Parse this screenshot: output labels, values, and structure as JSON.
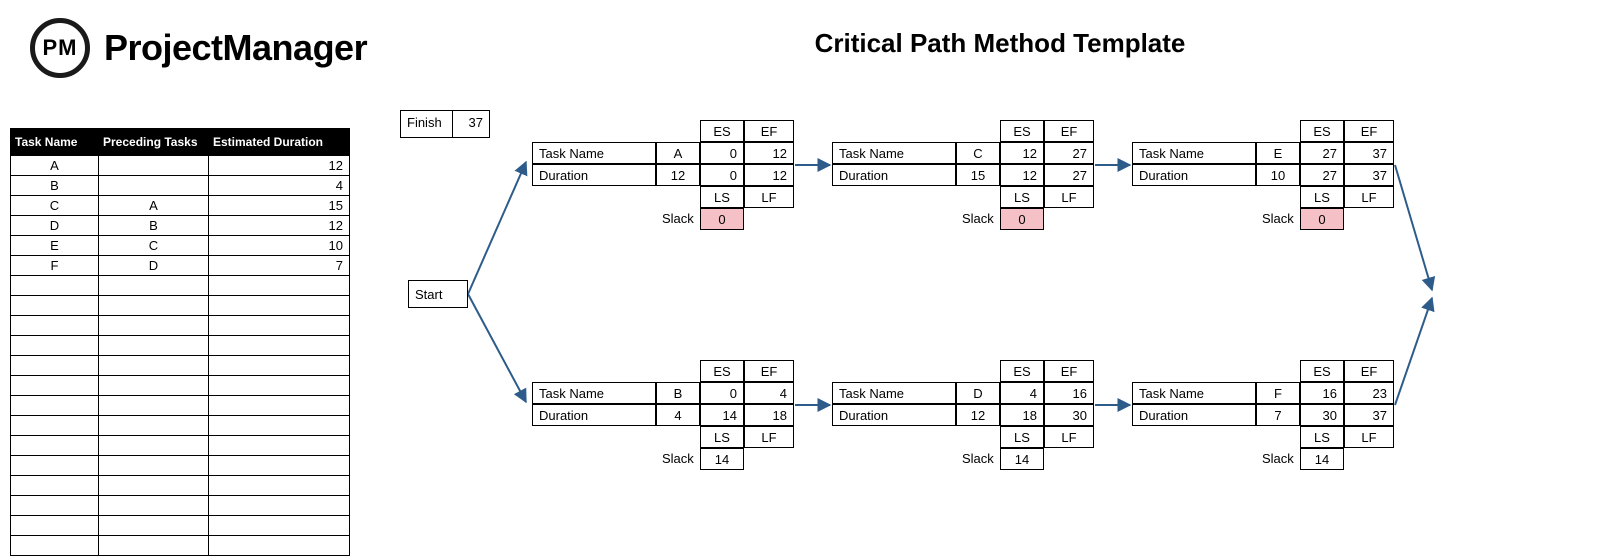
{
  "brand": {
    "abbr": "PM",
    "name": "ProjectManager"
  },
  "title": "Critical Path Method Template",
  "table": {
    "headers": {
      "task": "Task Name",
      "pred": "Preceding Tasks",
      "dur": "Estimated Duration"
    },
    "rows": [
      {
        "name": "A",
        "pred": "",
        "dur": "12"
      },
      {
        "name": "B",
        "pred": "",
        "dur": "4"
      },
      {
        "name": "C",
        "pred": "A",
        "dur": "15"
      },
      {
        "name": "D",
        "pred": "B",
        "dur": "12"
      },
      {
        "name": "E",
        "pred": "C",
        "dur": "10"
      },
      {
        "name": "F",
        "pred": "D",
        "dur": "7"
      }
    ]
  },
  "labels": {
    "start": "Start",
    "finish": "Finish",
    "task_name": "Task Name",
    "duration": "Duration",
    "es": "ES",
    "ef": "EF",
    "ls": "LS",
    "lf": "LF",
    "slack": "Slack"
  },
  "finish_value": "37",
  "nodes": {
    "A": {
      "task": "A",
      "dur": "12",
      "es": "0",
      "ef": "12",
      "ls": "0",
      "lf": "12",
      "slack": "0",
      "critical": true
    },
    "B": {
      "task": "B",
      "dur": "4",
      "es": "0",
      "ef": "4",
      "ls": "14",
      "lf": "18",
      "slack": "14",
      "critical": false
    },
    "C": {
      "task": "C",
      "dur": "15",
      "es": "12",
      "ef": "27",
      "ls": "12",
      "lf": "27",
      "slack": "0",
      "critical": true
    },
    "D": {
      "task": "D",
      "dur": "12",
      "es": "4",
      "ef": "16",
      "ls": "18",
      "lf": "30",
      "slack": "14",
      "critical": false
    },
    "E": {
      "task": "E",
      "dur": "10",
      "es": "27",
      "ef": "37",
      "ls": "27",
      "lf": "37",
      "slack": "0",
      "critical": true
    },
    "F": {
      "task": "F",
      "dur": "7",
      "es": "16",
      "ef": "23",
      "ls": "30",
      "lf": "37",
      "slack": "14",
      "critical": false
    }
  }
}
